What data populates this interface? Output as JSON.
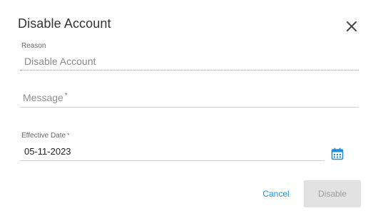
{
  "dialog": {
    "title": "Disable Account"
  },
  "form": {
    "reason": {
      "label": "Reason",
      "value": "Disable Account"
    },
    "message": {
      "placeholder": "Message",
      "required_mark": "*",
      "value": ""
    },
    "effective_date": {
      "label": "Effective Date",
      "required_mark": "*",
      "value": "05-11-2023"
    }
  },
  "actions": {
    "cancel_label": "Cancel",
    "disable_label": "Disable",
    "disable_enabled": false
  },
  "colors": {
    "accent": "#1f8fd6",
    "disabled_bg": "#e2e2e2",
    "disabled_text": "#9b9b9b"
  },
  "icons": {
    "close": "close-icon",
    "calendar": "calendar-icon"
  }
}
